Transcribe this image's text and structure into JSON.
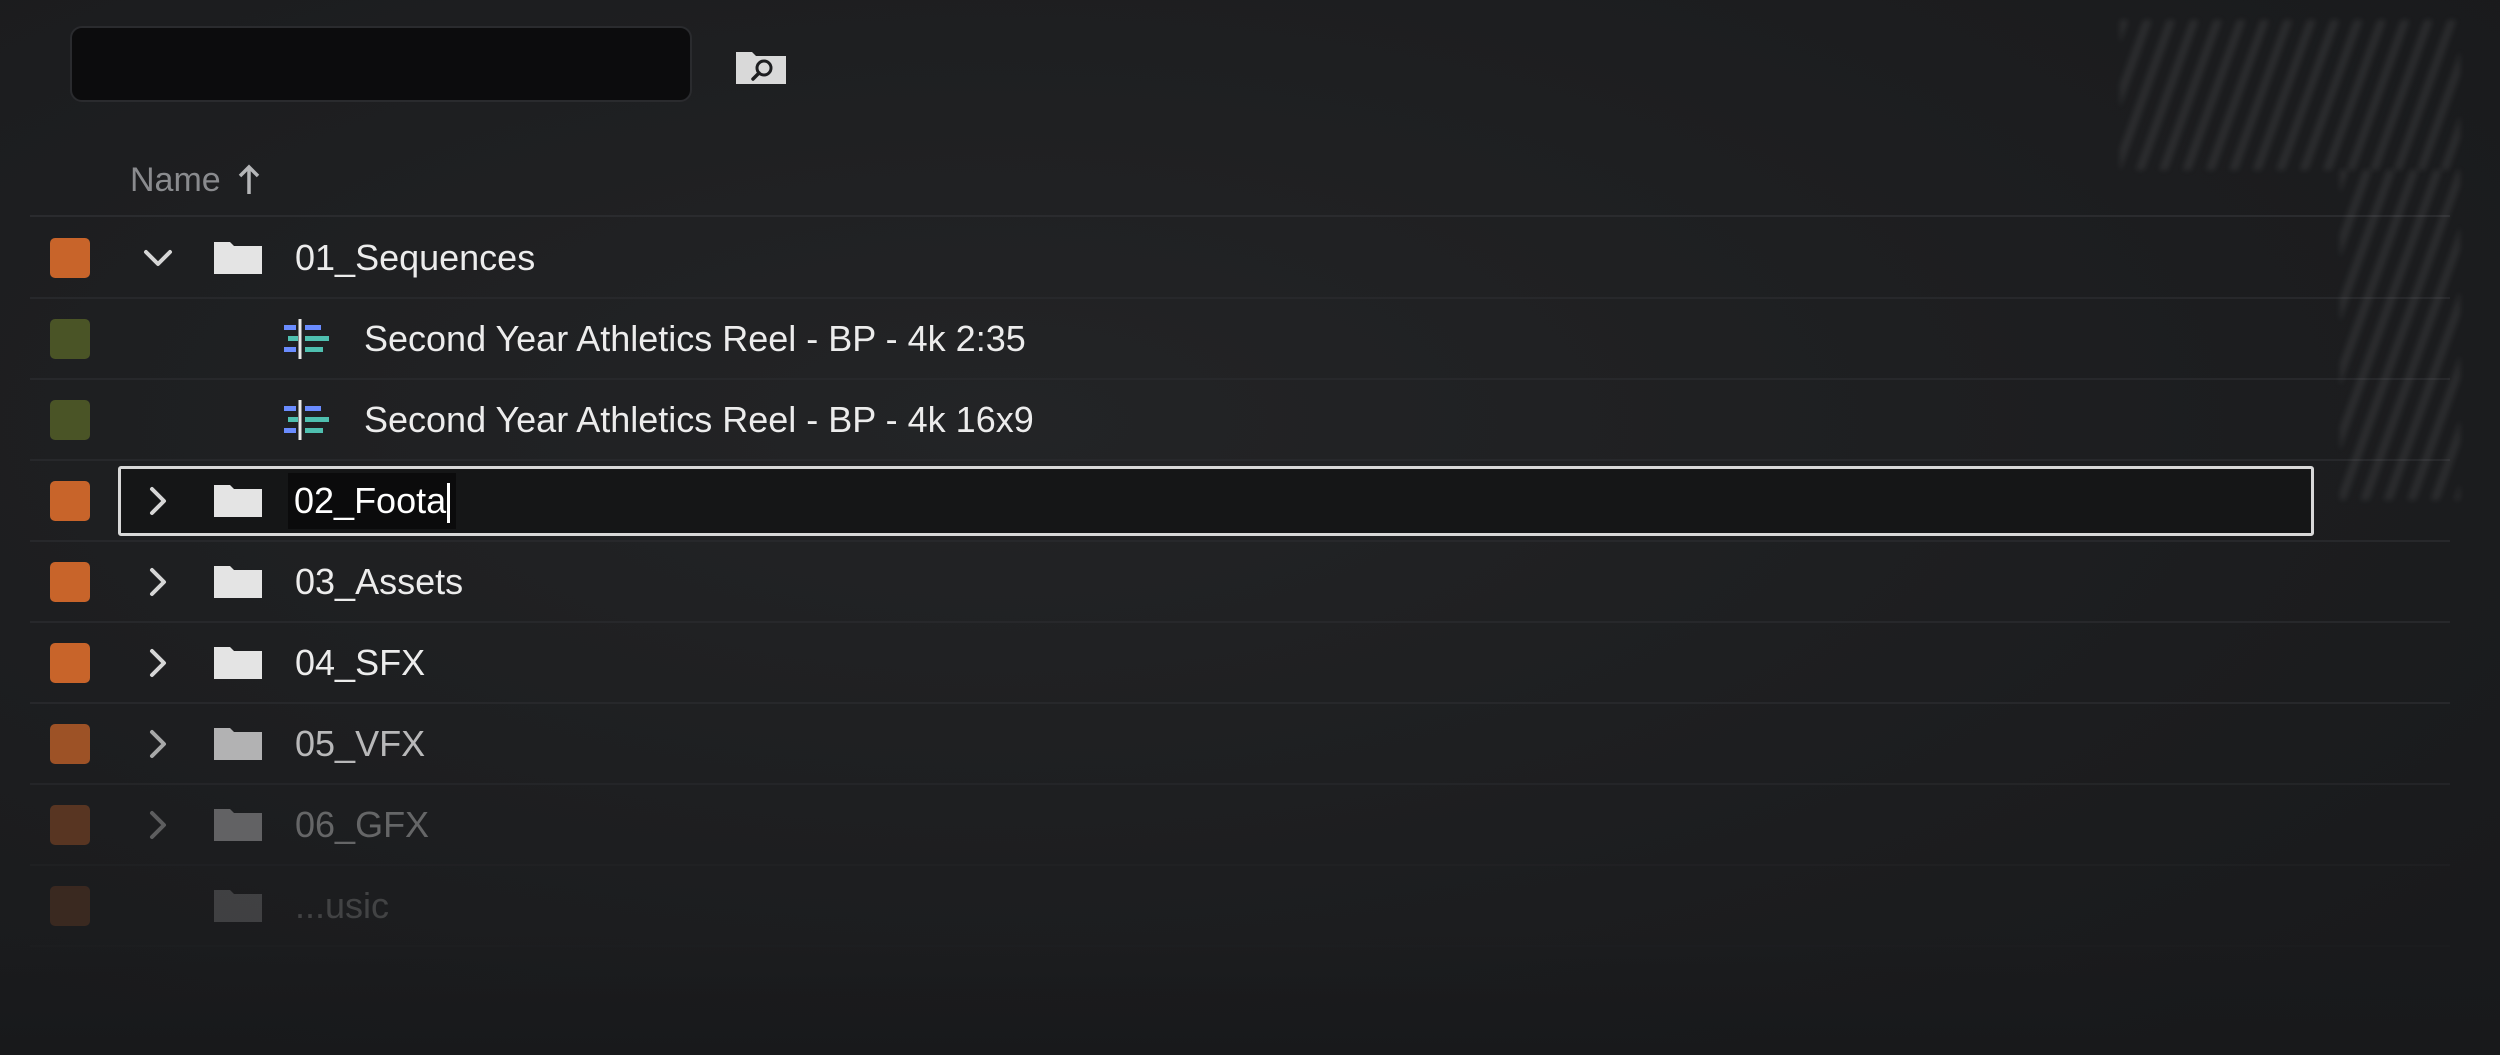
{
  "search": {
    "value": "",
    "placeholder": ""
  },
  "header": {
    "name_column": "Name",
    "sort_icon": "arrow-up-icon"
  },
  "colors": {
    "label_orange": "#c8642a",
    "label_olive": "#4a5426",
    "sequence_icon_teal": "#4fc0b0",
    "sequence_icon_blue": "#6a8cff"
  },
  "rows": [
    {
      "name": "01_Sequences",
      "type": "folder",
      "expanded": true,
      "label_color": "orange"
    },
    {
      "name": "Second Year Athletics Reel - BP - 4k 2:35",
      "type": "sequence",
      "label_color": "olive"
    },
    {
      "name": "Second Year Athletics Reel - BP - 4k 16x9",
      "type": "sequence",
      "label_color": "olive"
    },
    {
      "name": "02_Foota",
      "type": "folder",
      "expanded": false,
      "label_color": "orange",
      "renaming": true
    },
    {
      "name": "03_Assets",
      "type": "folder",
      "expanded": false,
      "label_color": "orange"
    },
    {
      "name": "04_SFX",
      "type": "folder",
      "expanded": false,
      "label_color": "orange"
    },
    {
      "name": "05_VFX",
      "type": "folder",
      "expanded": false,
      "label_color": "orange"
    },
    {
      "name": "06_GFX",
      "type": "folder",
      "expanded": false,
      "label_color": "orange"
    },
    {
      "name": "...usic",
      "type": "folder",
      "expanded": false,
      "label_color": "orange"
    }
  ]
}
